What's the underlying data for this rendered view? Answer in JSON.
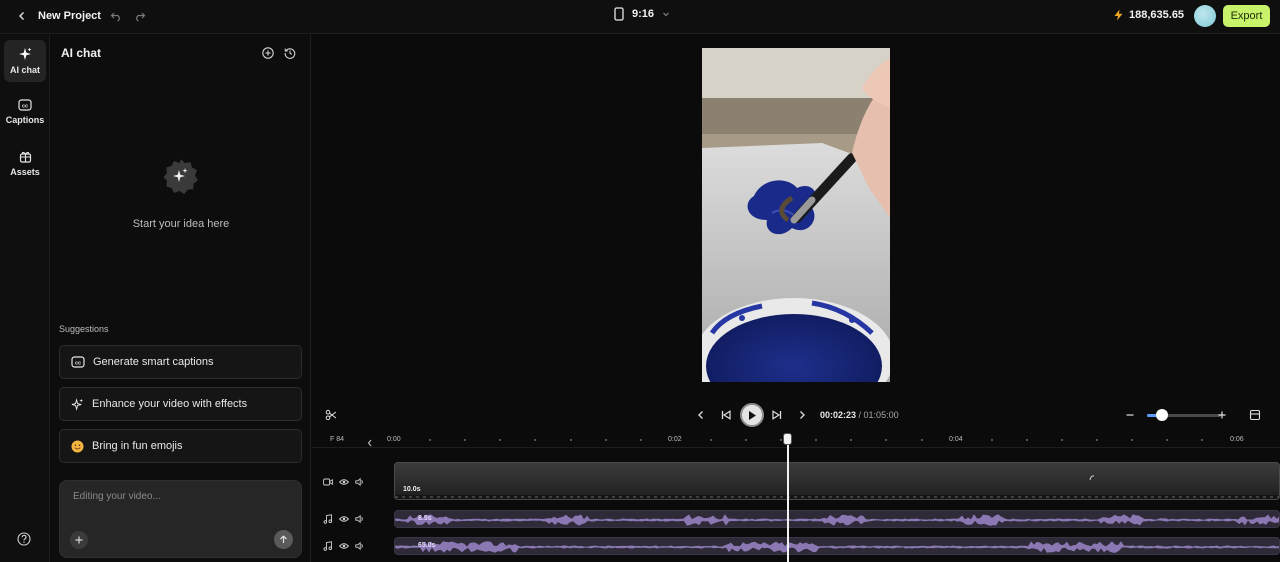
{
  "header": {
    "title": "New Project",
    "aspect_ratio": "9:16",
    "credits": "188,635.65",
    "export_label": "Export"
  },
  "rail": {
    "items": [
      {
        "label": "AI chat",
        "icon": "sparkles-icon",
        "active": true
      },
      {
        "label": "Captions",
        "icon": "cc-icon",
        "active": false
      },
      {
        "label": "Assets",
        "icon": "gift-box-icon",
        "active": false
      }
    ]
  },
  "chat": {
    "title": "AI chat",
    "empty_text": "Start your idea here",
    "suggestions_title": "Suggestions",
    "suggestions": [
      {
        "label": "Generate smart captions",
        "icon": "cc-icon"
      },
      {
        "label": "Enhance your video with effects",
        "icon": "sparkles-icon"
      },
      {
        "label": "Bring in fun emojis",
        "icon": "emoji-icon"
      }
    ],
    "input_placeholder": "Editing your video..."
  },
  "player": {
    "current_time": "00:02:23",
    "separator": " / ",
    "total_time": "01:05:00",
    "zoom_level": 0.2
  },
  "timeline": {
    "fps_label": "F 84",
    "ruler_labels": [
      "0:00",
      "0:02",
      "0:04",
      "0:06"
    ],
    "video_track": {
      "duration": "10.0s"
    },
    "audio_tracks": [
      {
        "duration": "8.5s"
      },
      {
        "duration": "65.0s"
      }
    ],
    "playhead_time": "00:02:23"
  },
  "colors": {
    "accent": "#c9f26b",
    "audio_wave": "#9b86c9",
    "zoom_accent": "#5b9cff"
  }
}
